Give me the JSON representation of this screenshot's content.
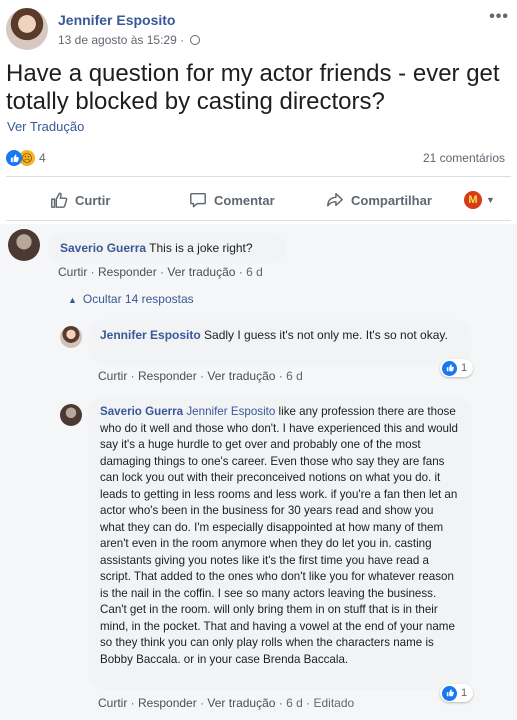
{
  "post": {
    "author": "Jennifer Esposito",
    "timestamp": "13 de agosto às 15:29 ·",
    "text": "Have a question for my actor friends - ever get totally blocked by casting directors?",
    "translate_label": "Ver Tradução",
    "reaction_count": "4",
    "comment_count": "21 comentários"
  },
  "actions": {
    "like": "Curtir",
    "comment": "Comentar",
    "share": "Compartilhar"
  },
  "comments": [
    {
      "author": "Saverio Guerra",
      "text": "This is a joke right?",
      "meta": {
        "like": "Curtir",
        "reply": "Responder",
        "translate": "Ver tradução",
        "time": "6 d"
      }
    }
  ],
  "hide_replies_label": "Ocultar 14 respostas",
  "replies": [
    {
      "author": "Jennifer Esposito",
      "text": "Sadly I guess it's not only me. It's so not okay.",
      "meta": {
        "like": "Curtir",
        "reply": "Responder",
        "translate": "Ver tradução",
        "time": "6 d"
      },
      "reactions": "1"
    },
    {
      "author": "Saverio Guerra",
      "tag": "Jennifer Esposito",
      "text": "like any profession there are those who do it well and those who don't. I have experienced this and would say it's a huge hurdle to get over and probably one of the most damaging things to one's career. Even those who say they are fans can lock you out with their preconceived notions on what you do. it leads to getting in less rooms and less work. if you're a fan then let an actor who's been in the business for 30 years read and show you what they can do. I'm especially disappointed at how many of them aren't even in the room anymore when they do let you in. casting assistants giving you notes like it's the first time you have read a script. That added to the ones who don't like you for whatever reason is the nail in the coffin. I see so many actors leaving the business. Can't get in the room. will only bring them in on stuff that is in their mind, in the pocket. That and having a vowel at the end of your name so they think you can only play rolls when the characters name is Bobby Baccala. or in your case Brenda Baccala.",
      "meta": {
        "like": "Curtir",
        "reply": "Responder",
        "translate": "Ver tradução",
        "time": "6 d",
        "edited": "Editado"
      },
      "reactions": "1"
    }
  ],
  "icons": {
    "like": "thumbs-up-icon",
    "comment": "speech-bubble-icon",
    "share": "share-arrow-icon",
    "globe": "globe-icon",
    "more": "more-options-icon"
  },
  "colors": {
    "link": "#385898",
    "like_blue": "#1877f2",
    "muted": "#616770"
  }
}
